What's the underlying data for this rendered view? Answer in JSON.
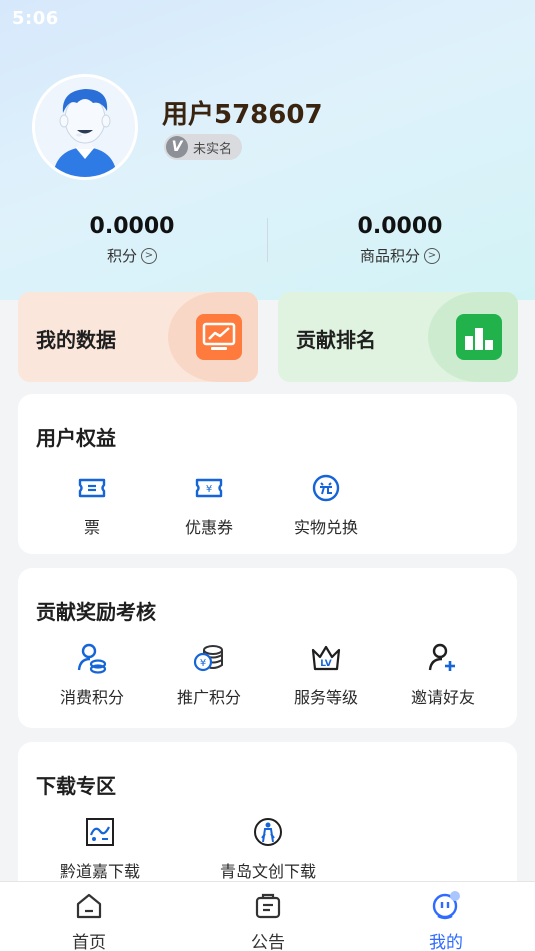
{
  "status_bar": {
    "time": "5:06"
  },
  "profile": {
    "username": "用户578607",
    "verify_badge": "未实名",
    "verify_mark": "V"
  },
  "stats": [
    {
      "value": "0.0000",
      "label": "积分"
    },
    {
      "value": "0.0000",
      "label": "商品积分"
    }
  ],
  "quick_cards": [
    {
      "label": "我的数据",
      "bg": "#fbe6dc",
      "icon_bg": "#ff7a3d"
    },
    {
      "label": "贡献排名",
      "bg": "#dff3e0",
      "icon_bg": "#22b24c"
    }
  ],
  "sections": {
    "benefits": {
      "title": "用户权益",
      "items": [
        {
          "label": "票",
          "icon": "ticket-icon"
        },
        {
          "label": "优惠券",
          "icon": "coupon-icon"
        },
        {
          "label": "实物兑换",
          "icon": "exchange-icon"
        }
      ]
    },
    "rewards": {
      "title": "贡献奖励考核",
      "items": [
        {
          "label": "消费积分",
          "icon": "consume-points-icon"
        },
        {
          "label": "推广积分",
          "icon": "promo-points-icon"
        },
        {
          "label": "服务等级",
          "icon": "crown-level-icon"
        },
        {
          "label": "邀请好友",
          "icon": "invite-friend-icon"
        }
      ]
    },
    "downloads": {
      "title": "下载专区",
      "items": [
        {
          "label": "黔道嘉下载",
          "icon": "qiandaojia-icon"
        },
        {
          "label": "青岛文创下载",
          "icon": "qingdao-wenchuang-icon"
        }
      ]
    }
  },
  "tabbar": [
    {
      "label": "首页",
      "icon": "home-icon"
    },
    {
      "label": "公告",
      "icon": "notice-icon"
    },
    {
      "label": "我的",
      "icon": "profile-icon",
      "active": true
    }
  ],
  "colors": {
    "accent": "#2f6bff",
    "icon_blue": "#1565d8"
  }
}
